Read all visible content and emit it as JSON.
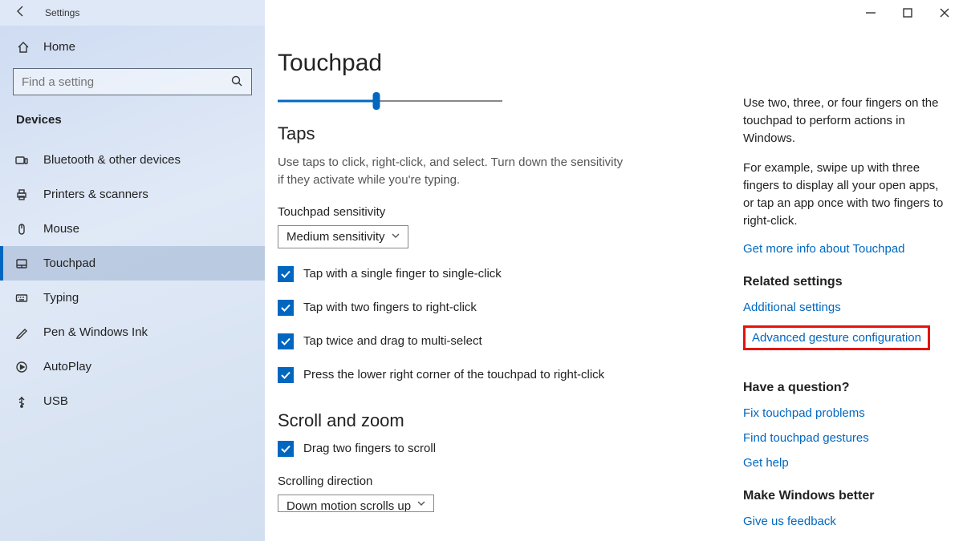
{
  "titlebar": {
    "title": "Settings"
  },
  "sidebar": {
    "home_label": "Home",
    "search_placeholder": "Find a setting",
    "section_label": "Devices",
    "items": [
      {
        "label": "Bluetooth & other devices"
      },
      {
        "label": "Printers & scanners"
      },
      {
        "label": "Mouse"
      },
      {
        "label": "Touchpad"
      },
      {
        "label": "Typing"
      },
      {
        "label": "Pen & Windows Ink"
      },
      {
        "label": "AutoPlay"
      },
      {
        "label": "USB"
      }
    ]
  },
  "main": {
    "page_title": "Touchpad",
    "taps": {
      "heading": "Taps",
      "description": "Use taps to click, right-click, and select. Turn down the sensitivity if they activate while you're typing.",
      "sensitivity_label": "Touchpad sensitivity",
      "sensitivity_value": "Medium sensitivity",
      "checks": [
        "Tap with a single finger to single-click",
        "Tap with two fingers to right-click",
        "Tap twice and drag to multi-select",
        "Press the lower right corner of the touchpad to right-click"
      ]
    },
    "scroll": {
      "heading": "Scroll and zoom",
      "check0": "Drag two fingers to scroll",
      "direction_label": "Scrolling direction",
      "direction_value": "Down motion scrolls up"
    }
  },
  "sidepanel": {
    "intro1": "Use two, three, or four fingers on the touchpad to perform actions in Windows.",
    "intro2": "For example, swipe up with three fingers to display all your open apps, or tap an app once with two fingers to right-click.",
    "info_link": "Get more info about Touchpad",
    "related_heading": "Related settings",
    "related_links": [
      "Additional settings",
      "Advanced gesture configuration"
    ],
    "question_heading": "Have a question?",
    "question_links": [
      "Fix touchpad problems",
      "Find touchpad gestures",
      "Get help"
    ],
    "better_heading": "Make Windows better",
    "better_link": "Give us feedback"
  }
}
